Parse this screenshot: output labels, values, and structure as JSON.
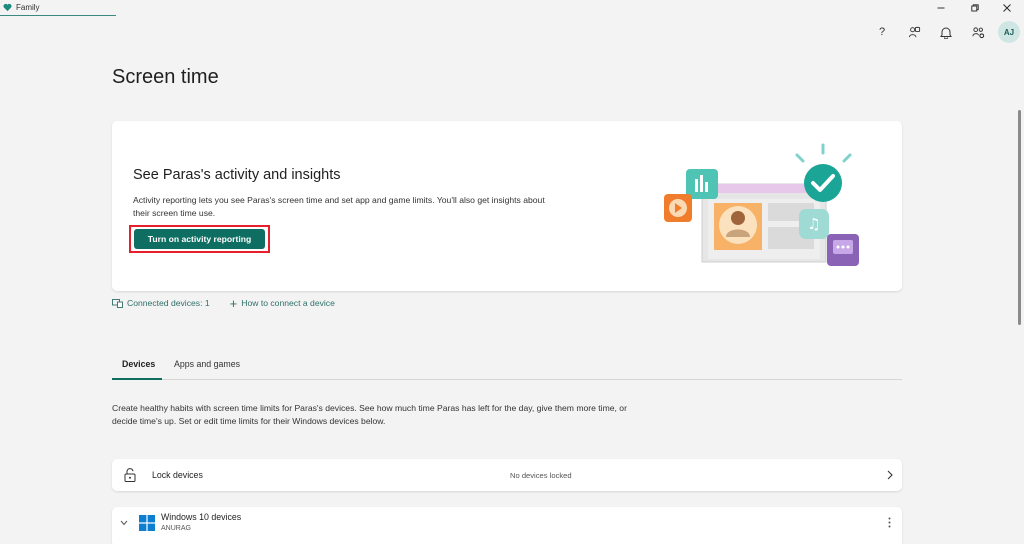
{
  "window": {
    "app_title": "Family",
    "controls": [
      "minimize-icon",
      "restore-icon",
      "close-icon"
    ]
  },
  "header_icons": [
    "help-icon",
    "family-members-icon",
    "notification-bell-icon",
    "settings-people-icon"
  ],
  "header": {
    "help_label": "?",
    "avatar_initials": "AJ"
  },
  "page": {
    "title": "Screen time"
  },
  "hero": {
    "title": "See Paras's activity and insights",
    "description": "Activity reporting lets you see Paras's screen time and set app and game limits. You'll also get insights about their screen time use.",
    "button_label": "Turn on activity reporting"
  },
  "links": {
    "connected_devices": "Connected devices: 1",
    "how_to_connect": "How to connect a device"
  },
  "tabs": [
    {
      "label": "Devices",
      "active": true
    },
    {
      "label": "Apps and games",
      "active": false
    }
  ],
  "devices_description": "Create healthy habits with screen time limits for Paras's devices. See how much time Paras has left for the day, give them more time, or decide time's up. Set or edit time limits for their Windows devices below.",
  "lock_devices": {
    "label": "Lock devices",
    "status": "No devices locked"
  },
  "windows_devices": {
    "label": "Windows 10 devices",
    "device_name": "ANURAG"
  },
  "colors": {
    "accent": "#0f6e62",
    "highlight_outline": "#e5202b",
    "link": "#2f6f68",
    "background": "#f3f3f3"
  }
}
